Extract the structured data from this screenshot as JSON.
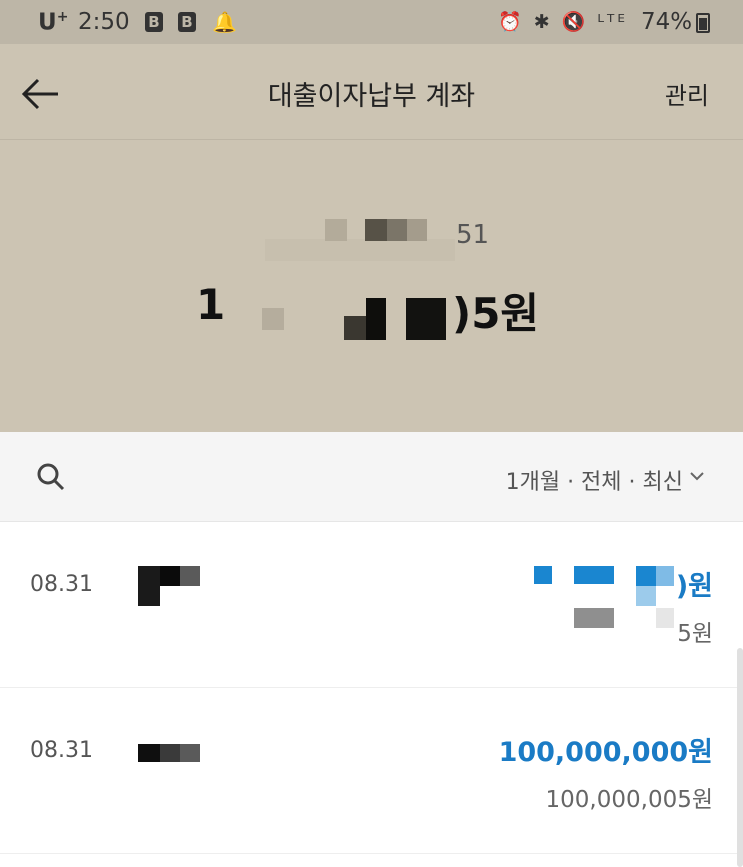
{
  "status_bar": {
    "carrier": "U",
    "carrier_sup": "+",
    "time": "2:50",
    "app_icon_letter": "B",
    "right_icons": "⏰ ✱ 🔇 ᴸᵀᴱ",
    "battery": "74%"
  },
  "header": {
    "title": "대출이자납부 계좌",
    "manage_label": "관리",
    "account_number_suffix": "51",
    "balance_prefix": "1",
    "balance_suffix": ")5원"
  },
  "filter": {
    "label": "1개월 · 전체 · 최신"
  },
  "transactions": [
    {
      "date": "08.31",
      "amount_suffix": ")원",
      "balance_suffix": "5원"
    },
    {
      "date": "08.31",
      "amount": "100,000,000원",
      "balance": "100,000,005원"
    }
  ],
  "colors": {
    "header_bg": "#ccc4b3",
    "accent_blue": "#1a7bc5"
  }
}
